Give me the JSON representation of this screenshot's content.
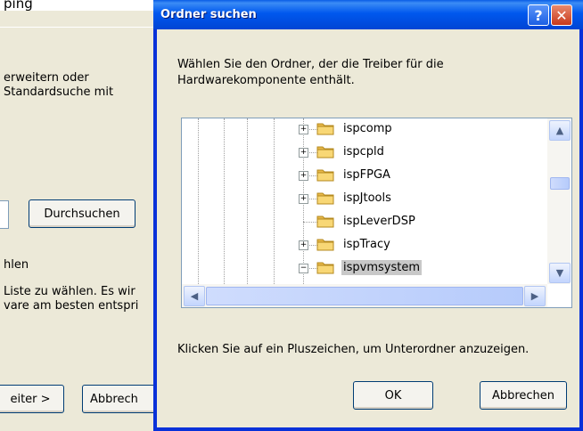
{
  "background_window": {
    "caption_fragment": "ping",
    "text_line_1": "erweitern oder",
    "text_line_2": "Standardsuche mit",
    "browse_button": "Durchsuchen",
    "text_line_3": "hlen",
    "text_line_4": "Liste zu wählen. Es wir",
    "text_line_5": "vare am besten entspri",
    "next_button": "eiter >",
    "cancel_button": "Abbrech"
  },
  "dialog": {
    "title": "Ordner suchen",
    "help_icon": "?",
    "close_icon": "✕",
    "prompt": "Wählen Sie den Ordner, der die Treiber für die\nHardwarekomponente enthält.",
    "tree_items": [
      {
        "label": "ispcomp",
        "expander": "+",
        "selected": false
      },
      {
        "label": "ispcpld",
        "expander": "+",
        "selected": false
      },
      {
        "label": "ispFPGA",
        "expander": "+",
        "selected": false
      },
      {
        "label": "ispJtools",
        "expander": "+",
        "selected": false
      },
      {
        "label": "ispLeverDSP",
        "expander": "",
        "selected": false
      },
      {
        "label": "ispTracy",
        "expander": "+",
        "selected": false
      },
      {
        "label": "ispvmsystem",
        "expander": "−",
        "selected": true
      }
    ],
    "hint": "Klicken Sie auf ein Pluszeichen, um Unterordner anzuzeigen.",
    "ok_button": "OK",
    "cancel_button": "Abbrechen",
    "colors": {
      "titlebar": "#0058ee",
      "face": "#ece9d8",
      "folder": "#f8d775"
    }
  }
}
